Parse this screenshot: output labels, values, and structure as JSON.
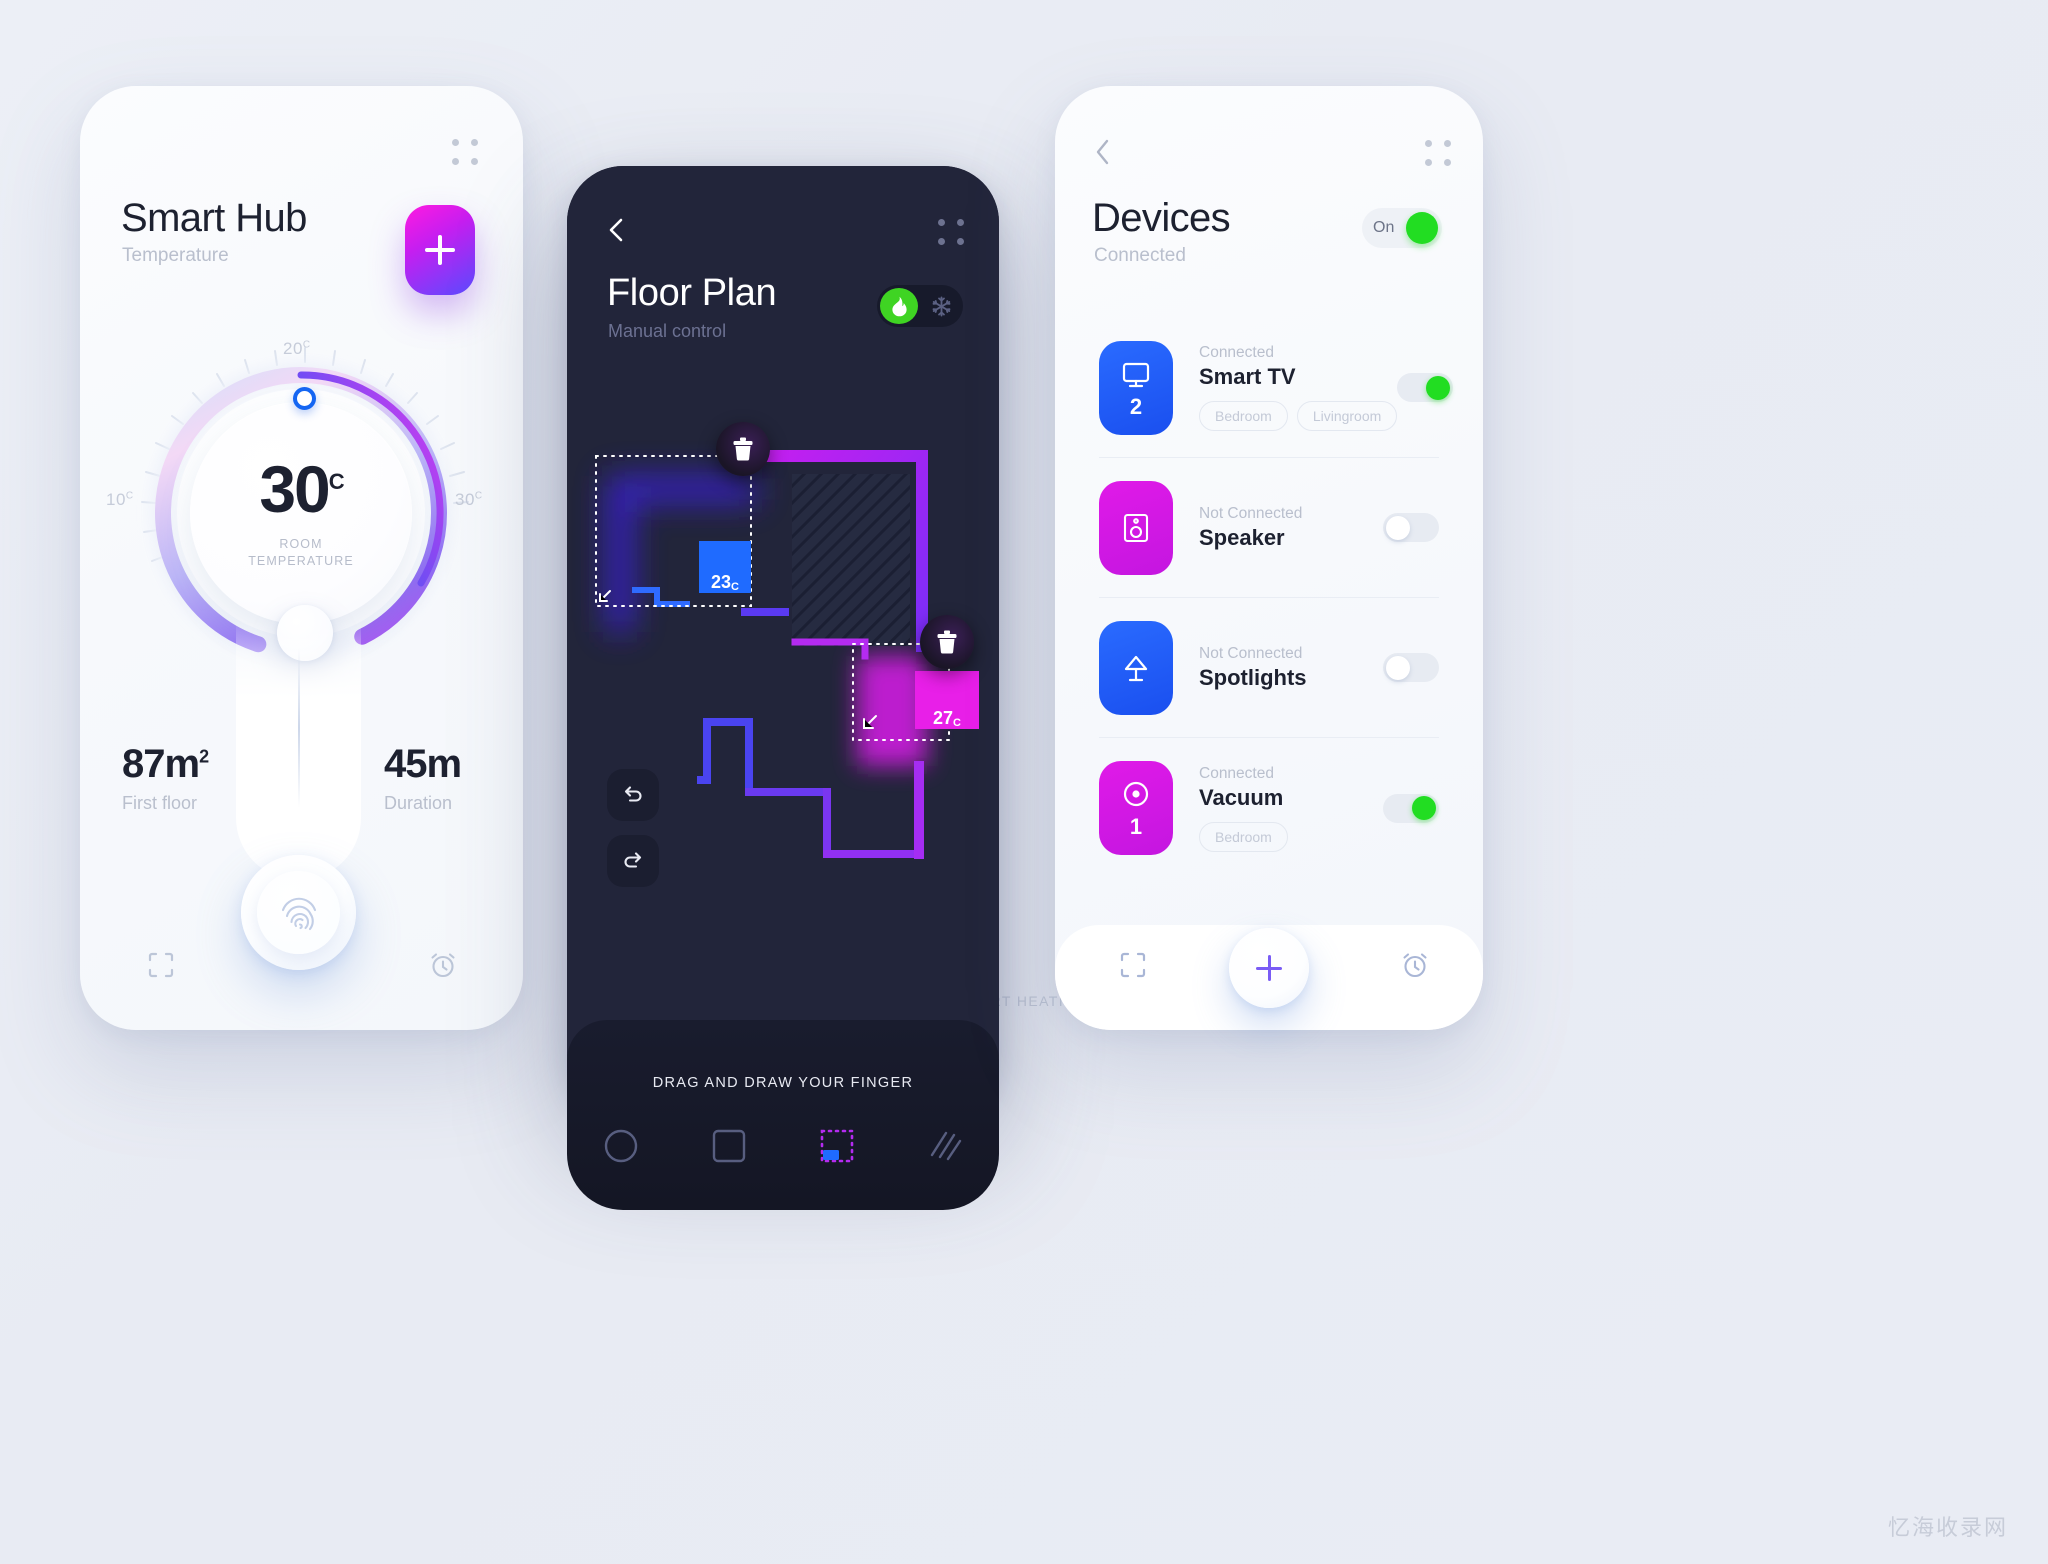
{
  "hub": {
    "title": "Smart Hub",
    "subtitle": "Temperature",
    "add_label": "+",
    "dial": {
      "value": "30",
      "unit": "C",
      "caption_line1": "ROOM",
      "caption_line2": "TEMPERATURE",
      "scale_min_label": "10",
      "scale_mid_label": "20",
      "scale_max_label": "30",
      "scale_unit": "C",
      "min": 10,
      "max": 30,
      "current": 30,
      "handle_top_value": 20,
      "accent_start": "#1566f2",
      "accent_end": "#b23cf0"
    },
    "stats": [
      {
        "value": "87m",
        "exponent": "2",
        "label": "First floor"
      },
      {
        "value": "45m",
        "exponent": "",
        "label": "Duration"
      }
    ],
    "action_label": "START HEATING",
    "nav": [
      {
        "icon": "scan-icon"
      },
      {
        "icon": "fingerprint-icon"
      },
      {
        "icon": "alarm-icon"
      }
    ]
  },
  "floor": {
    "title": "Floor Plan",
    "subtitle": "Manual control",
    "back_icon": "chevron-left-icon",
    "menu_icon": "grid-dots-icon",
    "mode_toggle": {
      "active": "heat",
      "options": [
        {
          "id": "heat",
          "icon": "flame-icon",
          "color": "#3fd423"
        },
        {
          "id": "cool",
          "icon": "snowflake-icon",
          "color": "#555b7d"
        }
      ]
    },
    "zones": [
      {
        "id": "zone-1",
        "temperature": "23",
        "unit": "C",
        "color": "#1f6bff"
      },
      {
        "id": "zone-2",
        "temperature": "27",
        "unit": "C",
        "color": "#e81fe8"
      }
    ],
    "history": [
      {
        "icon": "undo-icon"
      },
      {
        "icon": "redo-icon"
      }
    ],
    "hint": "DRAG AND DRAW YOUR FINGER",
    "tools": [
      {
        "id": "tool-circle",
        "icon": "circle-icon",
        "active": false
      },
      {
        "id": "tool-square",
        "icon": "square-icon",
        "active": false
      },
      {
        "id": "tool-select",
        "icon": "marquee-select-icon",
        "active": true
      },
      {
        "id": "tool-hatch",
        "icon": "hatch-fill-icon",
        "active": false
      }
    ]
  },
  "devices": {
    "back_icon": "chevron-left-icon",
    "menu_icon": "grid-dots-icon",
    "title": "Devices",
    "subtitle": "Connected",
    "master_toggle": {
      "label": "On",
      "state": true,
      "color": "#22dd22"
    },
    "items": [
      {
        "name": "Smart TV",
        "status": "Connected",
        "count": "2",
        "icon": "tv-icon",
        "tile_color": "#1f5eff",
        "toggle": true,
        "tags": [
          "Bedroom",
          "Livingroom"
        ]
      },
      {
        "name": "Speaker",
        "status": "Not Connected",
        "count": "",
        "icon": "speaker-icon",
        "tile_color": "#d916e8",
        "toggle": false,
        "tags": []
      },
      {
        "name": "Spotlights",
        "status": "Not Connected",
        "count": "",
        "icon": "spotlight-icon",
        "tile_color": "#1f5eff",
        "toggle": false,
        "tags": []
      },
      {
        "name": "Vacuum",
        "status": "Connected",
        "count": "1",
        "icon": "vacuum-icon",
        "tile_color": "#d916e8",
        "toggle": true,
        "tags": [
          "Bedroom"
        ]
      }
    ],
    "nav": [
      {
        "icon": "scan-icon"
      },
      {
        "icon": "plus-icon"
      },
      {
        "icon": "alarm-icon"
      }
    ]
  },
  "watermark": "忆海收录网"
}
